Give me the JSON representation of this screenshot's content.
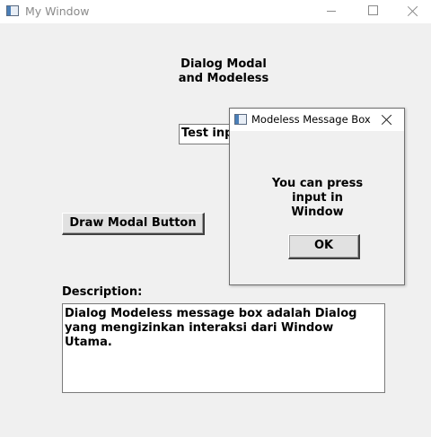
{
  "window": {
    "title": "My Window",
    "heading": "Dialog Modal\nand Modeless",
    "test_input_value": "Test input",
    "modal_button_label": "Draw Modal Button",
    "description_label": "Description:",
    "description_text": "Dialog Modeless message box adalah Dialog yang mengizinkan interaksi dari Window Utama."
  },
  "dialog": {
    "title": "Modeless Message Box",
    "message": "You can press\ninput in\nWindow",
    "ok_label": "OK"
  },
  "icons": {
    "app": "window-icon",
    "minimize": "minimize-icon",
    "maximize": "maximize-icon",
    "close": "close-icon"
  }
}
